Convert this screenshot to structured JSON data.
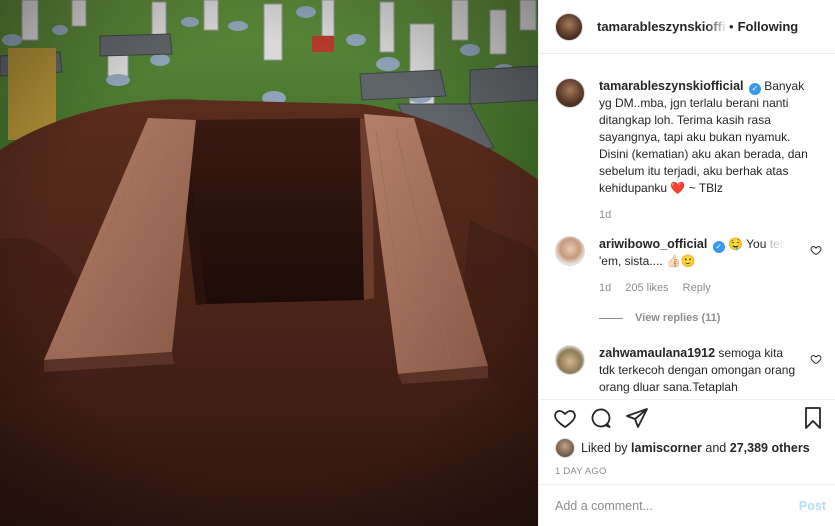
{
  "post": {
    "owner": "tamarableszynskiofficial",
    "separator": "•",
    "follow_status": "Following"
  },
  "caption": {
    "user": "tamarableszynskiofficial",
    "text": "Banyak yg DM..mba, jgn terlalu berani nanti ditangkap loh. Terima kasih rasa sayangnya, tapi aku bukan nyamuk. Disini (kematian) aku akan berada, dan sebelum itu terjadi, aku berhak atas kehidupanku",
    "heart": "❤️",
    "signoff": "~ TBlz",
    "time": "1d"
  },
  "comments": [
    {
      "user": "ariwibowo_official",
      "emoji": "🤤",
      "text_main": "You",
      "text_fade": "tell",
      "text_line2": "'em, sista....",
      "emoji2": "👍🏻🙂",
      "time": "1d",
      "likes": "205 likes",
      "reply": "Reply"
    },
    {
      "user": "zahwamaulana1912",
      "text": "semoga kita tdk terkecoh dengan omongan orang orang dluar sana.Tetaplah"
    }
  ],
  "view_replies": "View replies (11)",
  "actions": {
    "liked_prefix": "Liked by",
    "liked_user": "lamiscorner",
    "liked_and": "and",
    "liked_count": "27,389 others",
    "posted_ago": "1 DAY AGO"
  },
  "add_comment": {
    "placeholder": "Add a comment...",
    "post_label": "Post"
  },
  "colors": {
    "verified": "#3897f0",
    "heart_red": "#ed4956",
    "post_disabled": "#b2dffc"
  }
}
